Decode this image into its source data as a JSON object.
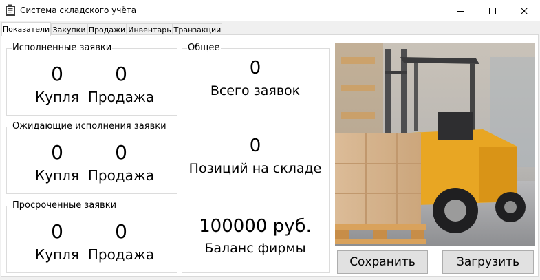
{
  "window": {
    "title": "Система складского учёта"
  },
  "tabs": [
    {
      "label": "Показатели"
    },
    {
      "label": "Закупки"
    },
    {
      "label": "Продажи"
    },
    {
      "label": "Инвентарь"
    },
    {
      "label": "Транзакции"
    }
  ],
  "groups": {
    "fulfilled": {
      "title": "Исполненные заявки",
      "buy_value": "0",
      "buy_label": "Купля",
      "sell_value": "0",
      "sell_label": "Продажа"
    },
    "pending": {
      "title": "Ожидающие исполнения заявки",
      "buy_value": "0",
      "buy_label": "Купля",
      "sell_value": "0",
      "sell_label": "Продажа"
    },
    "overdue": {
      "title": "Просроченные заявки",
      "buy_value": "0",
      "buy_label": "Купля",
      "sell_value": "0",
      "sell_label": "Продажа"
    }
  },
  "general": {
    "title": "Общее",
    "total_orders_value": "0",
    "total_orders_label": "Всего заявок",
    "stock_positions_value": "0",
    "stock_positions_label": "Позиций на складе",
    "balance_value": "100000 руб.",
    "balance_label": "Баланс фирмы"
  },
  "buttons": {
    "save": "Сохранить",
    "load": "Загрузить"
  },
  "icons": {
    "app": "clipboard-icon",
    "minimize": "minimize-icon",
    "maximize": "maximize-icon",
    "close": "close-icon",
    "image": "forklift-image"
  },
  "colors": {
    "forklift_body": "#e8a623",
    "pallet": "#d9a25c",
    "button_face": "#e1e1e1"
  }
}
